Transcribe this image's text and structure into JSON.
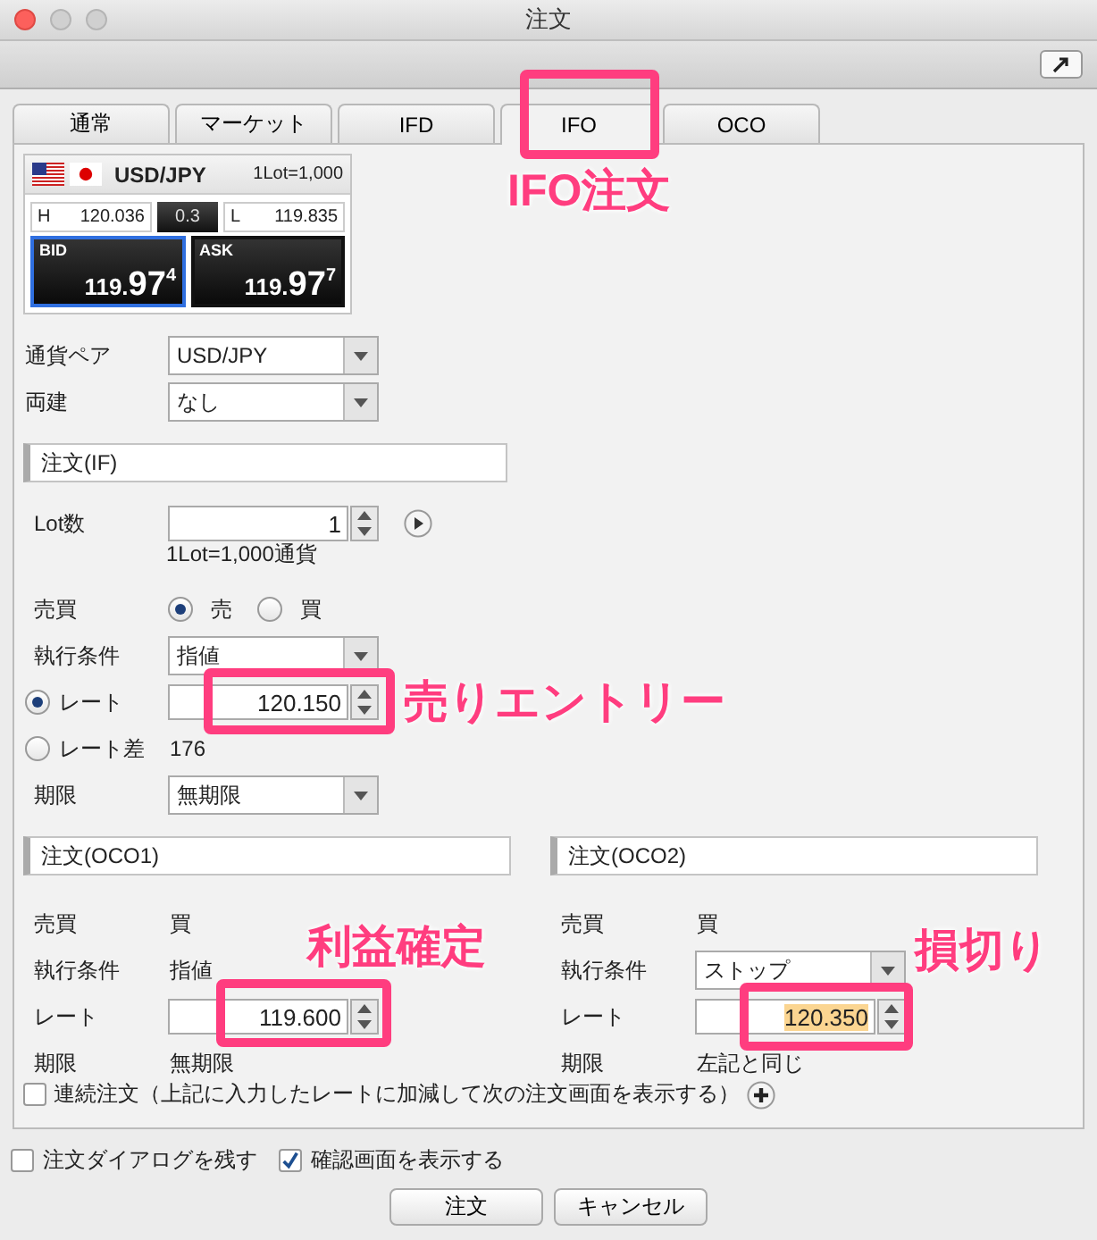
{
  "window": {
    "title": "注文"
  },
  "tabs": [
    {
      "label": "通常",
      "selected": false
    },
    {
      "label": "マーケット",
      "selected": false
    },
    {
      "label": "IFD",
      "selected": false
    },
    {
      "label": "IFO",
      "selected": true
    },
    {
      "label": "OCO",
      "selected": false
    }
  ],
  "quote": {
    "pair": "USD/JPY",
    "lot_info": "1Lot=1,000",
    "high_label": "H",
    "high": "120.036",
    "spread": "0.3",
    "low_label": "L",
    "low": "119.835",
    "bid": {
      "label": "BID",
      "price_main": "119.",
      "price_big": "97",
      "price_sup": "4",
      "selected": true
    },
    "ask": {
      "label": "ASK",
      "price_main": "119.",
      "price_big": "97",
      "price_sup": "7",
      "selected": false
    }
  },
  "settings": [
    {
      "label": "通貨ペア",
      "value": "USD/JPY"
    },
    {
      "label": "両建",
      "value": "なし"
    }
  ],
  "if_order": {
    "header": "注文(IF)",
    "lot": {
      "label": "Lot数",
      "value": "1",
      "note": "1Lot=1,000通貨"
    },
    "side": {
      "label": "売買",
      "options": [
        {
          "label": "売",
          "selected": true
        },
        {
          "label": "買",
          "selected": false
        }
      ]
    },
    "condition": {
      "label": "執行条件",
      "value": "指値"
    },
    "rate_modes": [
      {
        "label": "レート",
        "selected": true,
        "value": "120.150"
      },
      {
        "label": "レート差",
        "selected": false,
        "value": "176"
      }
    ],
    "expiry": {
      "label": "期限",
      "value": "無期限"
    }
  },
  "oco": [
    {
      "header": "注文(OCO1)",
      "rows": [
        {
          "kind": "text",
          "label": "売買",
          "value": "買"
        },
        {
          "kind": "text",
          "label": "執行条件",
          "value": "指値"
        },
        {
          "kind": "spinner",
          "label": "レート",
          "value": "119.600",
          "highlighted": false
        },
        {
          "kind": "text",
          "label": "期限",
          "value": "無期限"
        }
      ]
    },
    {
      "header": "注文(OCO2)",
      "rows": [
        {
          "kind": "text",
          "label": "売買",
          "value": "買"
        },
        {
          "kind": "select",
          "label": "執行条件",
          "value": "ストップ"
        },
        {
          "kind": "spinner",
          "label": "レート",
          "value": "120.350",
          "highlighted": true
        },
        {
          "kind": "text",
          "label": "期限",
          "value": "左記と同じ"
        }
      ]
    }
  ],
  "continuous": {
    "label": "連続注文（上記に入力したレートに加減して次の注文画面を表示する）",
    "checked": false
  },
  "options": [
    {
      "label": "注文ダイアログを残す",
      "checked": false
    },
    {
      "label": "確認画面を表示する",
      "checked": true
    }
  ],
  "buttons": [
    "注文",
    "キャンセル"
  ],
  "annotations": [
    {
      "text": "IFO注文"
    },
    {
      "text": "売りエントリー"
    },
    {
      "text": "利益確定"
    },
    {
      "text": "損切り"
    }
  ]
}
